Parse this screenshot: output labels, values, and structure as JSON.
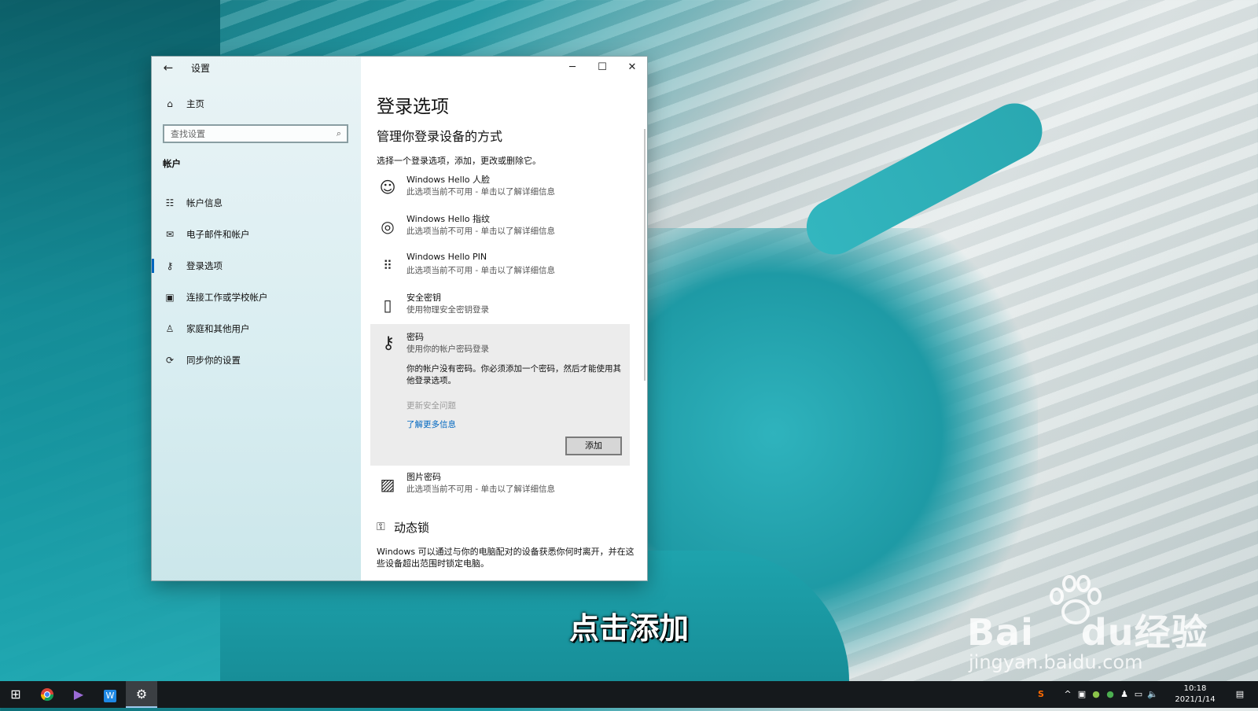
{
  "window": {
    "app_title": "设置",
    "controls": {
      "minimize": "─",
      "maximize": "☐",
      "close": "✕"
    }
  },
  "sidebar": {
    "home_label": "主页",
    "search_placeholder": "查找设置",
    "section_heading": "帐户",
    "items": [
      {
        "label": "帐户信息",
        "icon": "user-card-icon"
      },
      {
        "label": "电子邮件和帐户",
        "icon": "mail-icon"
      },
      {
        "label": "登录选项",
        "icon": "key-icon",
        "active": true
      },
      {
        "label": "连接工作或学校帐户",
        "icon": "briefcase-icon"
      },
      {
        "label": "家庭和其他用户",
        "icon": "person-icon"
      },
      {
        "label": "同步你的设置",
        "icon": "sync-icon"
      }
    ]
  },
  "content": {
    "title": "登录选项",
    "subtitle": "管理你登录设备的方式",
    "description": "选择一个登录选项，添加，更改或删除它。",
    "options": [
      {
        "name": "Windows Hello 人脸",
        "desc": "此选项当前不可用 - 单击以了解详细信息",
        "icon": "face-icon"
      },
      {
        "name": "Windows Hello 指纹",
        "desc": "此选项当前不可用 - 单击以了解详细信息",
        "icon": "fingerprint-icon"
      },
      {
        "name": "Windows Hello PIN",
        "desc": "此选项当前不可用 - 单击以了解详细信息",
        "icon": "pin-keypad-icon"
      },
      {
        "name": "安全密钥",
        "desc": "使用物理安全密钥登录",
        "icon": "usb-key-icon"
      }
    ],
    "password": {
      "name": "密码",
      "desc": "使用你的帐户密码登录",
      "note": "你的帐户没有密码。你必须添加一个密码，然后才能使用其他登录选项。",
      "disabled_link": "更新安全问题",
      "learn_more": "了解更多信息",
      "add_button": "添加"
    },
    "picture_password": {
      "name": "图片密码",
      "desc": "此选项当前不可用 - 单击以了解详细信息"
    },
    "dynamic_lock": {
      "title": "动态锁",
      "desc": "Windows 可以通过与你的电脑配对的设备获悉你何时离开，并在这些设备超出范围时锁定电脑。"
    }
  },
  "overlay": {
    "caption": "点击添加",
    "watermark_brand": "Bai",
    "watermark_brand2": "du",
    "watermark_cn": "经验",
    "watermark_url": "jingyan.baidu.com"
  },
  "taskbar": {
    "time": "10:18",
    "date": "2021/1/14",
    "apps": [
      "start-icon",
      "chrome-icon",
      "media-player-icon",
      "store-icon",
      "settings-gear-icon"
    ]
  },
  "colors": {
    "accent": "#0067c0",
    "taskbar": "#15191c"
  }
}
